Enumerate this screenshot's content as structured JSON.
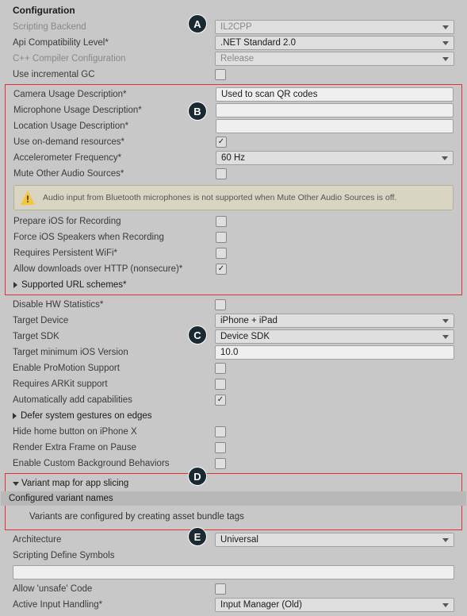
{
  "header": "Configuration",
  "badges": [
    "A",
    "B",
    "C",
    "D",
    "E"
  ],
  "top": [
    {
      "label": "Scripting Backend",
      "value": "IL2CPP",
      "dim": true,
      "type": "sel"
    },
    {
      "label": "Api Compatibility Level*",
      "value": ".NET Standard 2.0",
      "type": "sel"
    },
    {
      "label": "C++ Compiler Configuration",
      "value": "Release",
      "dim": true,
      "type": "sel"
    },
    {
      "label": "Use incremental GC",
      "type": "chk",
      "on": false
    }
  ],
  "box1": [
    {
      "label": "Camera Usage Description*",
      "type": "txt",
      "value": "Used to scan QR codes"
    },
    {
      "label": "Microphone Usage Description*",
      "type": "txt",
      "value": ""
    },
    {
      "label": "Location Usage Description*",
      "type": "txt",
      "value": ""
    },
    {
      "label": "Use on-demand resources*",
      "type": "chk",
      "on": true
    },
    {
      "label": "Accelerometer Frequency*",
      "type": "sel",
      "value": "60 Hz"
    },
    {
      "label": "Mute Other Audio Sources*",
      "type": "chk",
      "on": false
    }
  ],
  "warn": "Audio input from Bluetooth microphones is not supported when Mute Other Audio Sources is off.",
  "box1b": [
    {
      "label": "Prepare iOS for Recording",
      "type": "chk",
      "on": false
    },
    {
      "label": "Force iOS Speakers when Recording",
      "type": "chk",
      "on": false
    },
    {
      "label": "Requires Persistent WiFi*",
      "type": "chk",
      "on": false
    },
    {
      "label": "Allow downloads over HTTP (nonsecure)*",
      "type": "chk",
      "on": true
    }
  ],
  "fold1": "Supported URL schemes*",
  "mid": [
    {
      "label": "Disable HW Statistics*",
      "type": "chk",
      "on": false
    },
    {
      "label": "Target Device",
      "type": "sel",
      "value": "iPhone + iPad"
    },
    {
      "label": "Target SDK",
      "type": "sel",
      "value": "Device SDK"
    },
    {
      "label": "Target minimum iOS Version",
      "type": "txt",
      "value": "10.0"
    },
    {
      "label": "Enable ProMotion Support",
      "type": "chk",
      "on": false
    },
    {
      "label": "Requires ARKit support",
      "type": "chk",
      "on": false
    },
    {
      "label": "Automatically add capabilities",
      "type": "chk",
      "on": true
    }
  ],
  "fold2": "Defer system gestures on edges",
  "mid2": [
    {
      "label": "Hide home button on iPhone X",
      "type": "chk",
      "on": false
    },
    {
      "label": "Render Extra Frame on Pause",
      "type": "chk",
      "on": false
    },
    {
      "label": "Enable Custom Background Behaviors",
      "type": "chk",
      "on": false
    }
  ],
  "box2": {
    "fold": "Variant map for app slicing",
    "sub": "Configured variant names",
    "msg": "Variants are configured by creating asset bundle tags"
  },
  "bot": [
    {
      "label": "Architecture",
      "type": "sel",
      "value": "Universal"
    },
    {
      "label": "Scripting Define Symbols",
      "type": "wide"
    },
    {
      "label": "Allow 'unsafe' Code",
      "type": "chk",
      "on": false
    },
    {
      "label": "Active Input Handling*",
      "type": "sel",
      "value": "Input Manager (Old)"
    }
  ]
}
